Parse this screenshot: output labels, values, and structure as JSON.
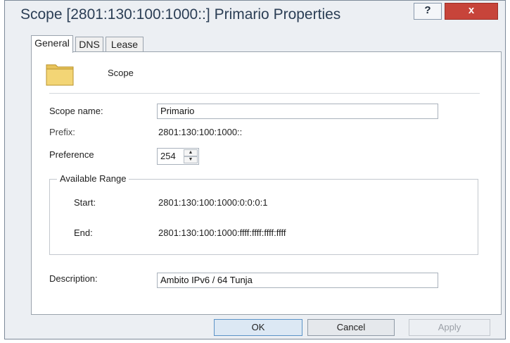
{
  "window": {
    "title": "Scope [2801:130:100:1000::] Primario Properties",
    "help_label": "?",
    "close_label": "x"
  },
  "tabs": [
    {
      "label": "General",
      "active": true
    },
    {
      "label": "DNS",
      "active": false
    },
    {
      "label": "Lease",
      "active": false
    }
  ],
  "general": {
    "icon": "folder-icon",
    "heading": "Scope",
    "scope_name_label": "Scope name:",
    "scope_name_value": "Primario",
    "prefix_label": "Prefix:",
    "prefix_value": "2801:130:100:1000::",
    "preference_label": "Preference",
    "preference_value": "254",
    "range": {
      "title": "Available Range",
      "start_label": "Start:",
      "start_value": "2801:130:100:1000:0:0:0:1",
      "end_label": "End:",
      "end_value": "2801:130:100:1000:ffff:ffff:ffff:ffff"
    },
    "description_label": "Description:",
    "description_value": "Ambito IPv6 / 64 Tunja"
  },
  "buttons": {
    "ok": "OK",
    "cancel": "Cancel",
    "apply": "Apply"
  },
  "colors": {
    "close": "#c7443a",
    "window_bg": "#eceff3",
    "title_text": "#2b3e55"
  }
}
